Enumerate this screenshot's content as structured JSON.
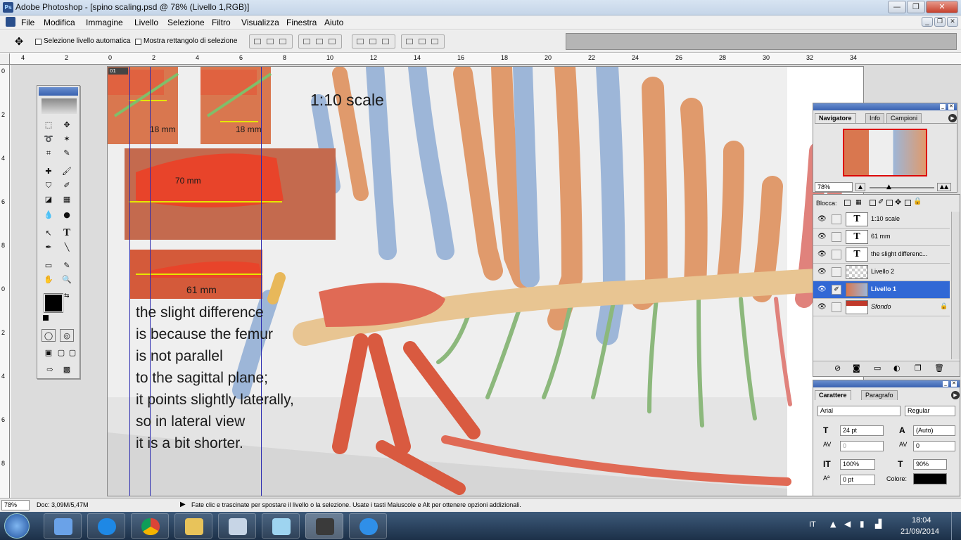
{
  "window": {
    "title": "Adobe Photoshop - [spino scaling.psd @ 78% (Livello 1,RGB)]",
    "minimize": "—",
    "maximize": "❐",
    "close": "✕",
    "doc_minimize": "_",
    "doc_restore": "❐",
    "doc_close": "✕"
  },
  "menu": [
    "File",
    "Modifica",
    "Immagine",
    "Livello",
    "Selezione",
    "Filtro",
    "Visualizza",
    "Finestra",
    "Aiuto"
  ],
  "options": {
    "auto_select": "Selezione livello automatica",
    "show_bounds": "Mostra rettangolo di selezione"
  },
  "ruler": {
    "h": [
      "4",
      "2",
      "0",
      "2",
      "4",
      "6",
      "8",
      "10",
      "12",
      "14",
      "16",
      "18",
      "20",
      "22",
      "24",
      "26",
      "28",
      "30",
      "32",
      "34"
    ],
    "v": [
      "0",
      "2",
      "4",
      "6",
      "8",
      "0",
      "2",
      "4",
      "6",
      "8"
    ]
  },
  "canvas": {
    "doc_tab": "01",
    "scale_label": "1:10 scale",
    "m18a": "18 mm",
    "m18b": "18 mm",
    "m70": "70 mm",
    "m61": "61 mm",
    "note": [
      "the slight difference",
      "is because the femur",
      "is not parallel",
      "to the sagittal plane;",
      "it points slightly laterally,",
      "so in lateral view",
      "it is a bit shorter."
    ]
  },
  "navigator": {
    "tabs": [
      "Navigatore",
      "Info",
      "Campioni"
    ],
    "zoom": "78%"
  },
  "layers": {
    "lock_label": "Blocca:",
    "rows": [
      {
        "name": "1:10 scale",
        "thumb": "T",
        "selected": false
      },
      {
        "name": "61 mm",
        "thumb": "T",
        "selected": false
      },
      {
        "name": "the slight differenc...",
        "thumb": "T",
        "selected": false
      },
      {
        "name": "Livello 2",
        "thumb": "",
        "selected": false
      },
      {
        "name": "Livello 1",
        "thumb": "",
        "selected": true
      },
      {
        "name": "Sfondo",
        "thumb": "",
        "selected": false
      }
    ]
  },
  "character": {
    "tabs": [
      "Carattere",
      "Paragrafo"
    ],
    "font": "Arial",
    "style": "Regular",
    "size": "24 pt",
    "leading": "(Auto)",
    "kerning": "0",
    "tracking": "0",
    "vscale": "100%",
    "hscale": "90%",
    "baseline": "0 pt",
    "color_label": "Colore:",
    "color": "#000000"
  },
  "status": {
    "zoom": "78%",
    "doc": "Doc: 3,09M/5,47M",
    "hint": "Fate clic e trascinate per spostare il livello o la selezione.  Usate i tasti Maiuscole e Alt per ottenere opzioni addizionali."
  },
  "taskbar": {
    "lang": "IT",
    "time": "18:04",
    "date": "21/09/2014"
  }
}
